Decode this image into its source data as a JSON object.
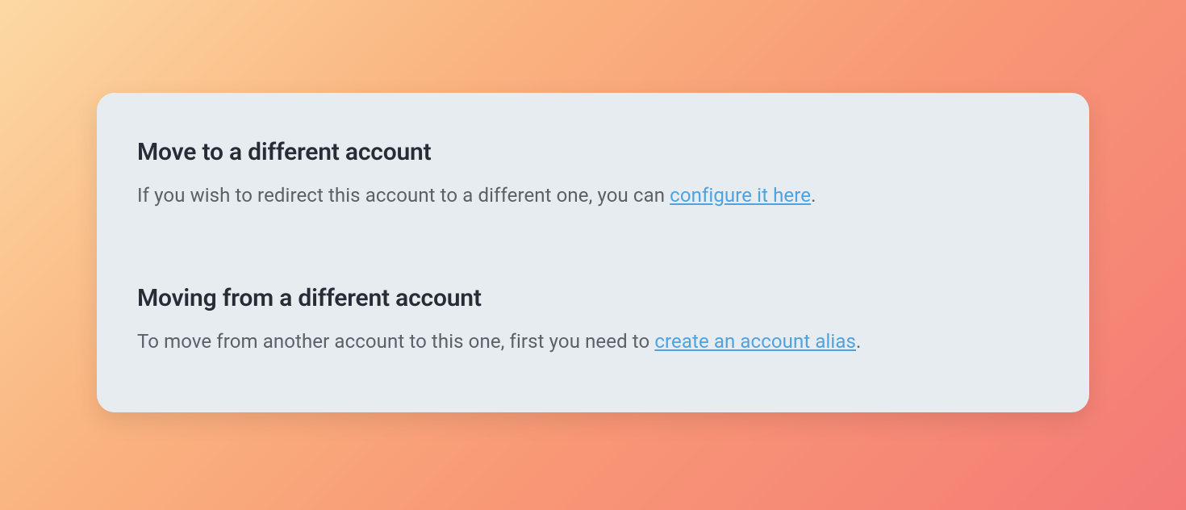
{
  "sections": {
    "move_to": {
      "title": "Move to a different account",
      "desc_prefix": "If you wish to redirect this account to a different one, you can ",
      "link_text": "configure it here",
      "desc_suffix": "."
    },
    "move_from": {
      "title": "Moving from a different account",
      "desc_prefix": "To move from another account to this one, first you need to ",
      "link_text": "create an account alias",
      "desc_suffix": "."
    }
  }
}
